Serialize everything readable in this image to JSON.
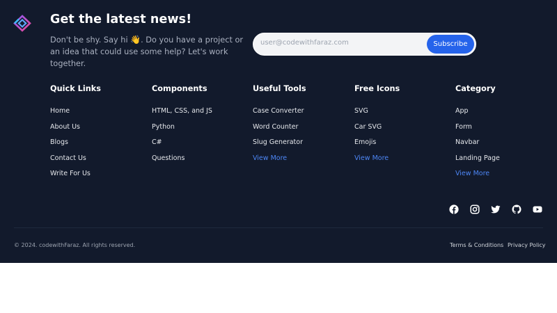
{
  "newsletter": {
    "title": "Get the latest news!",
    "desc_before": "Don't be shy. Say hi ",
    "wave": "👋",
    "desc_after": ". Do you have a project or an idea that could use some help? Let's work together.",
    "email_placeholder": "user@codewithfaraz.com",
    "subscribe_label": "Subscribe"
  },
  "columns": [
    {
      "title": "Quick Links",
      "links": [
        "Home",
        "About Us",
        "Blogs",
        "Contact Us",
        "Write For Us"
      ]
    },
    {
      "title": "Components",
      "links": [
        "HTML, CSS, and JS",
        "Python",
        "C#",
        "Questions"
      ]
    },
    {
      "title": "Useful Tools",
      "links": [
        "Case Converter",
        "Word Counter",
        "Slug Generator",
        "View More"
      ]
    },
    {
      "title": "Free Icons",
      "links": [
        "SVG",
        "Car SVG",
        "Emojis",
        "View More"
      ]
    },
    {
      "title": "Category",
      "links": [
        "App",
        "Form",
        "Navbar",
        "Landing Page",
        "View More"
      ]
    }
  ],
  "social": [
    "facebook-icon",
    "instagram-icon",
    "twitter-icon",
    "github-icon",
    "youtube-icon"
  ],
  "bottom": {
    "copyright": "© 2024. codewithFaraz. All rights reserved.",
    "terms": "Terms & Conditions",
    "privacy": "Privacy Policy"
  },
  "colors": {
    "footer_bg": "#121a2c",
    "accent": "#2563eb",
    "view_more_link": "#4d86f5"
  }
}
